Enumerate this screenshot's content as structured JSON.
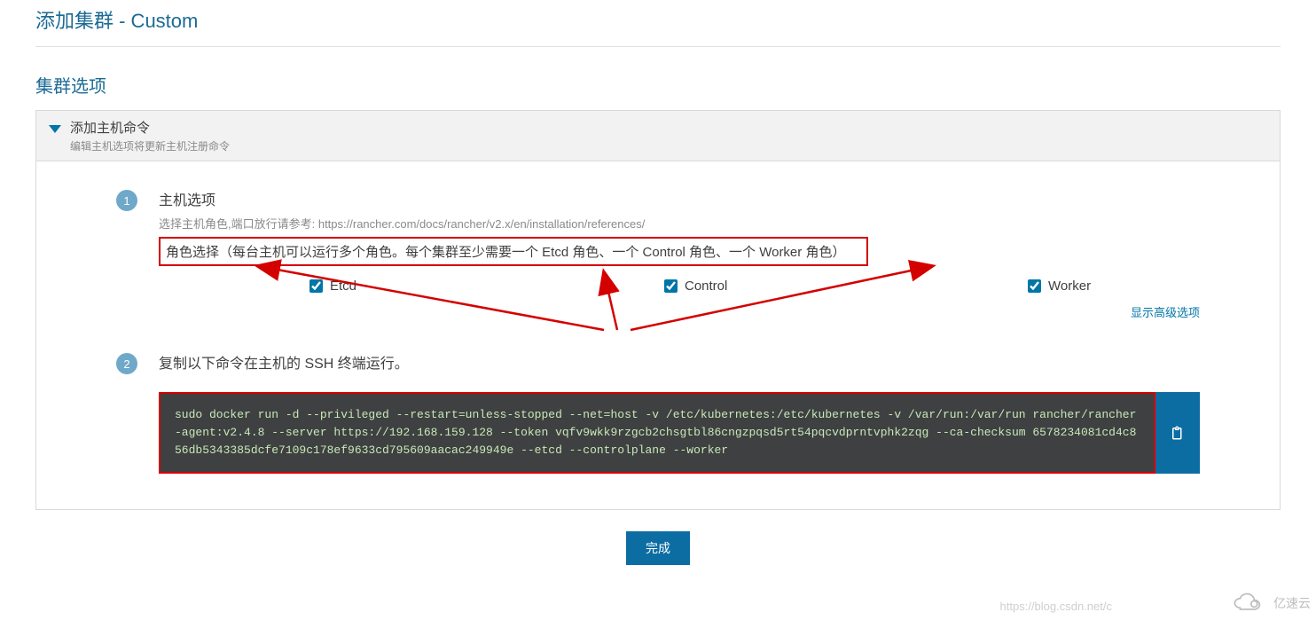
{
  "page_title": "添加集群 - Custom",
  "section_title": "集群选项",
  "panel": {
    "header_title": "添加主机命令",
    "header_sub": "编辑主机选项将更新主机注册命令"
  },
  "step1": {
    "badge": "1",
    "title": "主机选项",
    "sub_prefix": "选择主机角色,端口放行请参考: ",
    "sub_link": "https://rancher.com/docs/rancher/v2.x/en/installation/references/",
    "role_note": "角色选择（每台主机可以运行多个角色。每个集群至少需要一个 Etcd 角色、一个 Control 角色、一个 Worker 角色）",
    "roles": {
      "etcd": {
        "label": "Etcd",
        "checked": true
      },
      "control": {
        "label": "Control",
        "checked": true
      },
      "worker": {
        "label": "Worker",
        "checked": true
      }
    },
    "advanced_link": "显示高级选项"
  },
  "step2": {
    "badge": "2",
    "title": "复制以下命令在主机的 SSH 终端运行。",
    "command": "sudo docker run -d --privileged --restart=unless-stopped --net=host -v /etc/kubernetes:/etc/kubernetes -v /var/run:/var/run rancher/rancher-agent:v2.4.8 --server https://192.168.159.128 --token vqfv9wkk9rzgcb2chsgtbl86cngzpqsd5rt54pqcvdprntvphk2zqg --ca-checksum 6578234081cd4c856db5343385dcfe7109c178ef9633cd795609aacac249949e --etcd --controlplane --worker"
  },
  "done_label": "完成",
  "watermark_url": "https://blog.csdn.net/c",
  "watermark_brand": "亿速云"
}
